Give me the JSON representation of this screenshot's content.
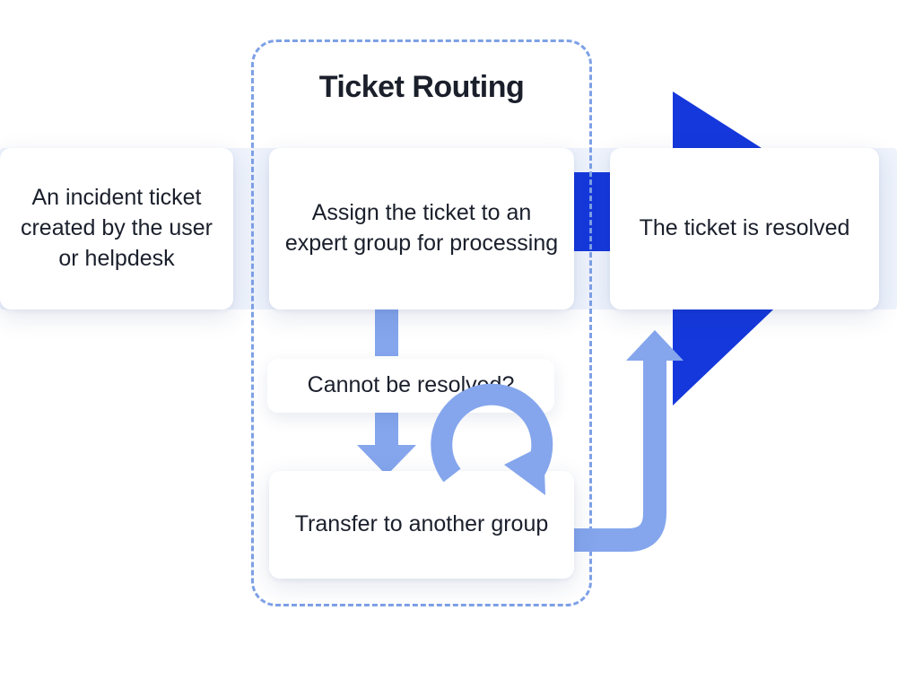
{
  "title": "Ticket Routing",
  "colors": {
    "dark_arrow": "#1538dc",
    "light_arrow": "#85a6ed",
    "band": "#eef3fc",
    "dashed_border": "#7ea1e6",
    "text": "#1a1f2b"
  },
  "nodes": {
    "incident": "An incident ticket created by the user or helpdesk",
    "assign": "Assign the ticket to an expert group for processing",
    "cannot_resolve": "Cannot be resolved?",
    "transfer": "Transfer to another group",
    "resolved": "The ticket is resolved"
  },
  "edges": [
    {
      "from": "incident",
      "to": "assign",
      "kind": "flow"
    },
    {
      "from": "assign",
      "to": "resolved",
      "kind": "flow"
    },
    {
      "from": "assign",
      "to": "cannot_resolve",
      "kind": "decision-down"
    },
    {
      "from": "cannot_resolve",
      "to": "transfer",
      "kind": "down"
    },
    {
      "from": "transfer",
      "to": "assign",
      "kind": "loop-back"
    },
    {
      "from": "transfer",
      "to": "resolved",
      "kind": "up-right"
    }
  ]
}
